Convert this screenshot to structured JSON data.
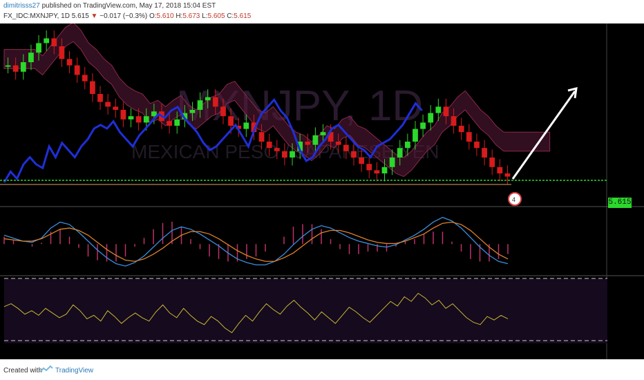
{
  "header": {
    "author": "dimitrisss27",
    "published": "published on TradingView.com, May 17, 2018 15:04 EST",
    "symbol": "FX_IDC:MXNJPY, 1D",
    "last": "5.615",
    "arrow": "▼",
    "change": "−0.017 (−0.3%)",
    "o_label": "O:",
    "o_value": "5.610",
    "h_label": "H:",
    "h_value": "5.673",
    "l_label": "L:",
    "l_value": "5.605",
    "c_label": "C:",
    "c_value": "5.615"
  },
  "watermark": {
    "line1": "MXNJPY, 1D",
    "line2": "MEXICAN PESO / JAPANESE YEN"
  },
  "price_label": "5.615",
  "event_badge": "4",
  "footer": {
    "created": "Created with",
    "brand": "TradingView"
  },
  "colors": {
    "background": "#000000",
    "up_candle": "#2bd82b",
    "down_candle": "#d81b1b",
    "overlay_line": "#1f2fd8",
    "kumo": "#5a1a3a",
    "macd": "#3a8fe0",
    "signal": "#e0812a",
    "histogram": "#c0306a",
    "oscillator": "#c8b832",
    "price_line": "#2bd82b"
  },
  "chart_data": [
    {
      "type": "line",
      "panel": "price",
      "title": "FX_IDC:MXNJPY, 1D",
      "legend": [],
      "last_price": 5.615,
      "ohlc": {
        "open": 5.61,
        "high": 5.673,
        "low": 5.605,
        "close": 5.615
      },
      "note_candles": "daily candlesticks with cloud and comparison line",
      "close_series": [
        0.78,
        0.74,
        0.8,
        0.86,
        0.92,
        0.95,
        0.9,
        0.82,
        0.78,
        0.72,
        0.68,
        0.6,
        0.55,
        0.52,
        0.5,
        0.44,
        0.46,
        0.42,
        0.46,
        0.49,
        0.43,
        0.4,
        0.44,
        0.48,
        0.5,
        0.56,
        0.58,
        0.52,
        0.46,
        0.4,
        0.38,
        0.42,
        0.36,
        0.3,
        0.26,
        0.24,
        0.2,
        0.24,
        0.3,
        0.28,
        0.34,
        0.36,
        0.3,
        0.28,
        0.24,
        0.2,
        0.16,
        0.12,
        0.1,
        0.14,
        0.2,
        0.26,
        0.3,
        0.38,
        0.42,
        0.48,
        0.52,
        0.46,
        0.4,
        0.36,
        0.3,
        0.26,
        0.2,
        0.14,
        0.1,
        0.08
      ],
      "comparison_series": [
        0.5,
        0.44,
        0.48,
        0.4,
        0.36,
        0.4,
        0.42,
        0.3,
        0.36,
        0.28,
        0.32,
        0.36,
        0.3,
        0.26,
        0.2,
        0.18,
        0.2,
        0.16,
        0.22,
        0.26,
        0.3,
        0.24,
        0.2,
        0.16,
        0.12,
        0.14,
        0.1,
        0.08,
        0.14,
        0.18,
        0.22,
        0.28,
        0.32,
        0.3,
        0.26,
        0.22,
        0.18,
        0.24,
        0.3,
        0.2,
        0.12,
        0.08,
        0.04,
        0.1,
        0.14,
        0.22,
        0.32,
        0.38,
        0.36,
        0.3,
        0.26,
        0.2,
        0.18,
        0.22,
        0.26,
        0.3,
        0.32,
        0.36,
        0.3,
        0.28,
        0.26,
        0.22,
        0.18,
        0.12,
        0.06,
        0.1
      ]
    },
    {
      "type": "line",
      "panel": "macd",
      "series": [
        {
          "values": [
            0.6,
            0.55,
            0.5,
            0.48,
            0.55,
            0.72,
            0.82,
            0.78,
            0.65,
            0.5,
            0.35,
            0.22,
            0.12,
            0.08,
            0.14,
            0.25,
            0.4,
            0.55,
            0.68,
            0.74,
            0.7,
            0.62,
            0.52,
            0.42,
            0.3,
            0.2,
            0.14,
            0.1,
            0.1,
            0.16,
            0.28,
            0.44,
            0.58,
            0.7,
            0.76,
            0.72,
            0.64,
            0.56,
            0.5,
            0.46,
            0.42,
            0.4,
            0.44,
            0.52,
            0.6,
            0.7,
            0.82,
            0.9,
            0.84,
            0.72,
            0.56,
            0.4,
            0.26,
            0.16,
            0.12
          ]
        },
        {
          "values": [
            0.54,
            0.52,
            0.5,
            0.5,
            0.54,
            0.62,
            0.7,
            0.72,
            0.68,
            0.6,
            0.48,
            0.36,
            0.26,
            0.18,
            0.16,
            0.2,
            0.28,
            0.38,
            0.5,
            0.6,
            0.66,
            0.66,
            0.62,
            0.54,
            0.44,
            0.34,
            0.26,
            0.2,
            0.16,
            0.16,
            0.22,
            0.3,
            0.42,
            0.54,
            0.64,
            0.68,
            0.68,
            0.64,
            0.58,
            0.52,
            0.48,
            0.46,
            0.46,
            0.5,
            0.56,
            0.62,
            0.72,
            0.8,
            0.82,
            0.78,
            0.68,
            0.54,
            0.4,
            0.28,
            0.2
          ]
        }
      ]
    },
    {
      "type": "line",
      "panel": "oscillator",
      "series": [
        {
          "values": [
            0.55,
            0.6,
            0.52,
            0.42,
            0.48,
            0.4,
            0.52,
            0.44,
            0.36,
            0.42,
            0.58,
            0.48,
            0.34,
            0.4,
            0.3,
            0.48,
            0.38,
            0.26,
            0.36,
            0.44,
            0.36,
            0.3,
            0.46,
            0.58,
            0.44,
            0.36,
            0.52,
            0.4,
            0.3,
            0.24,
            0.38,
            0.3,
            0.18,
            0.1,
            0.26,
            0.4,
            0.3,
            0.46,
            0.6,
            0.5,
            0.42,
            0.56,
            0.66,
            0.54,
            0.44,
            0.32,
            0.46,
            0.36,
            0.26,
            0.4,
            0.54,
            0.46,
            0.36,
            0.28,
            0.4,
            0.52,
            0.64,
            0.56,
            0.72,
            0.64,
            0.78,
            0.7,
            0.58,
            0.66,
            0.52,
            0.6,
            0.48,
            0.36,
            0.28,
            0.24,
            0.38,
            0.32,
            0.4,
            0.34
          ]
        }
      ],
      "grid": "dashed upper and lower bands"
    }
  ]
}
